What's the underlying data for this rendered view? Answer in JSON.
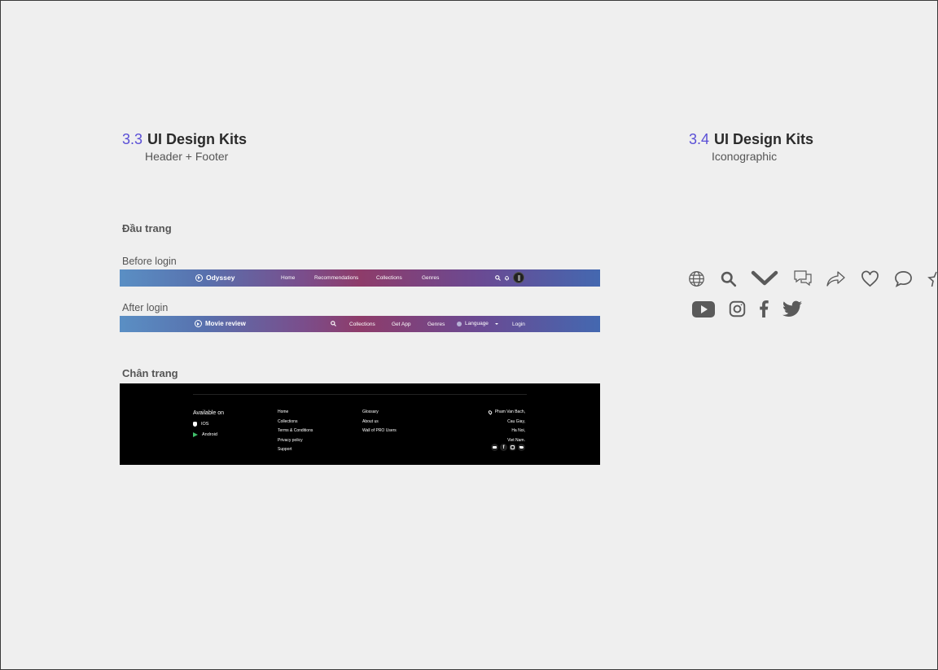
{
  "left_section": {
    "number": "3.3",
    "title": "UI Design Kits",
    "subtitle": "Header + Footer"
  },
  "right_section": {
    "number": "3.4",
    "title": "UI Design Kits",
    "subtitle": "Iconographic"
  },
  "header_label": "Đầu trang",
  "before_login": {
    "label": "Before login",
    "brand": "Odyssey",
    "nav": [
      "Home",
      "Recommendations",
      "Collections",
      "Genres"
    ]
  },
  "after_login": {
    "label": "After login",
    "brand": "Movie review",
    "nav": [
      "Collections",
      "Get App",
      "Genres",
      "Language",
      "Login"
    ]
  },
  "footer_label": "Chân trang",
  "footer": {
    "available_on": "Available on",
    "platforms": [
      "IOS",
      "Android"
    ],
    "col1": [
      "Home",
      "Collections",
      "Terms & Conditions",
      "Privacy policy",
      "Support"
    ],
    "col2": [
      "Glossary",
      "About us",
      "Wall of PRO Users"
    ],
    "address": [
      "Pham Van Bach,",
      "Cau Giay,",
      "Ha Noi,",
      "Viet Nam."
    ]
  },
  "iconography": {
    "row1": [
      "globe-icon",
      "search-icon",
      "chevron-down-icon",
      "chat-bubbles-icon",
      "share-icon",
      "heart-icon",
      "comment-icon",
      "star-icon"
    ],
    "row2": [
      "youtube-icon",
      "instagram-icon",
      "facebook-icon",
      "twitter-icon"
    ]
  },
  "colors": {
    "accent": "#5a4fd6",
    "icon": "#5a5a5a",
    "footer_bg": "#000000"
  }
}
